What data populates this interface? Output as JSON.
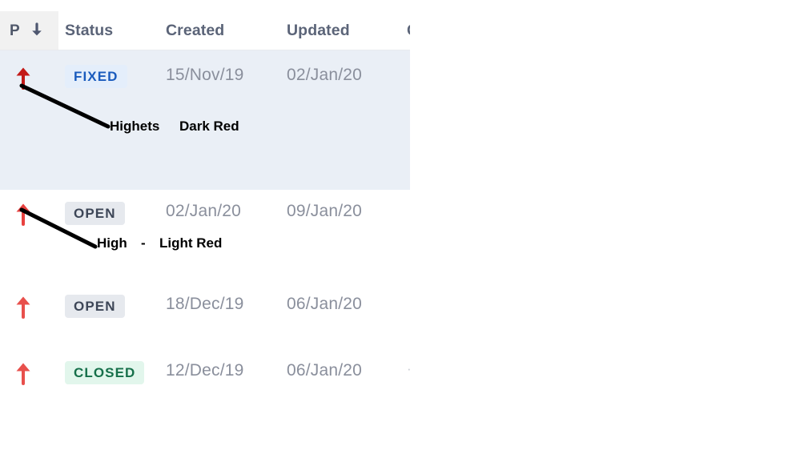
{
  "table": {
    "columns": [
      {
        "key": "priority",
        "label": "P",
        "sorted": true,
        "sort_icon": "arrow-down-icon"
      },
      {
        "key": "status",
        "label": "Status",
        "sorted": false
      },
      {
        "key": "created",
        "label": "Created",
        "sorted": false
      },
      {
        "key": "updated",
        "label": "Updated",
        "sorted": false
      },
      {
        "key": "cut",
        "label": "C",
        "sorted": false
      }
    ],
    "rows": [
      {
        "priority_icon": "arrow-up-icon",
        "priority_color": "#c31a18",
        "priority_level": "Highest",
        "status": "FIXED",
        "status_style": "fixed",
        "created": "15/Nov/19",
        "updated": "02/Jan/20",
        "cut": "",
        "selected": true
      },
      {
        "priority_icon": "arrow-up-icon",
        "priority_color": "#e8413f",
        "priority_level": "High",
        "status": "OPEN",
        "status_style": "open",
        "created": "02/Jan/20",
        "updated": "09/Jan/20",
        "cut": "",
        "selected": false
      },
      {
        "priority_icon": "arrow-up-icon",
        "priority_color": "#e8504c",
        "priority_level": "High",
        "status": "OPEN",
        "status_style": "open",
        "created": "18/Dec/19",
        "updated": "06/Jan/20",
        "cut": "",
        "selected": false
      },
      {
        "priority_icon": "arrow-up-icon",
        "priority_color": "#e8504c",
        "priority_level": "High",
        "status": "CLOSED",
        "status_style": "closed",
        "created": "12/Dec/19",
        "updated": "06/Jan/20",
        "cut": "·",
        "selected": false
      }
    ]
  },
  "annotations": [
    {
      "id": "anno-highest",
      "label": "Highets",
      "note": "Dark Red"
    },
    {
      "id": "anno-high",
      "label": "High",
      "dash": "-",
      "note": "Light Red"
    }
  ],
  "colors": {
    "selected_row": "#eaeff6",
    "header_cell_highlight": "#f1f1f1",
    "badge_fixed_bg": "#e4eefb",
    "badge_fixed_text": "#1a5bbd",
    "badge_open_bg": "#e6e9ee",
    "badge_open_text": "#3d4657",
    "badge_closed_bg": "#e2f6ec",
    "badge_closed_text": "#16704a",
    "priority_highest": "#c31a18",
    "priority_high": "#e8504c",
    "annotation_ink": "#000000",
    "date_text": "#8a8f9c",
    "header_text": "#5b6478"
  }
}
